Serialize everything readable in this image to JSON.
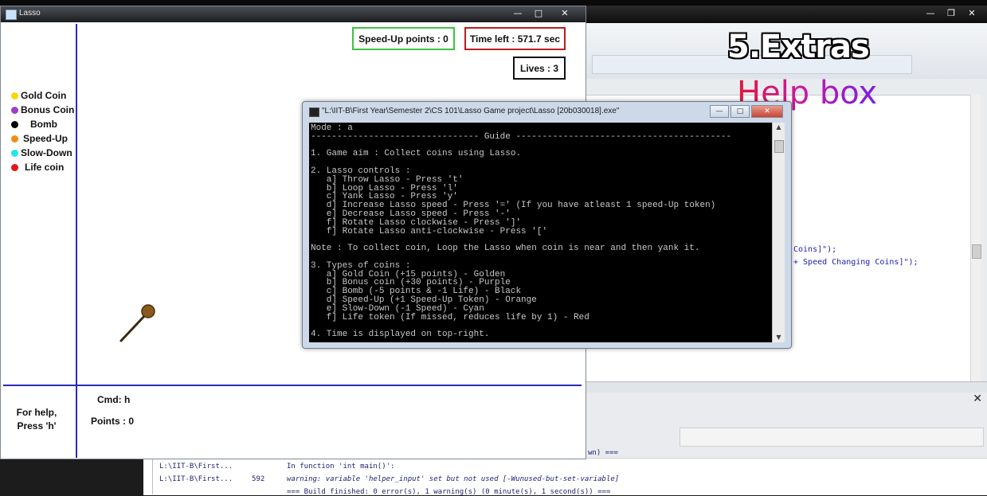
{
  "lasso_window": {
    "title": "Lasso",
    "buttons": {
      "minimize": "—",
      "maximize": "□",
      "close": "✕"
    },
    "legend": [
      {
        "label": "Gold Coin",
        "color": "#f5d90a"
      },
      {
        "label": "Bonus Coin",
        "color": "#9b3fc4"
      },
      {
        "label": "Bomb",
        "color": "#000000"
      },
      {
        "label": "Speed-Up",
        "color": "#f28c18"
      },
      {
        "label": "Slow-Down",
        "color": "#22e6ee"
      },
      {
        "label": "Life coin",
        "color": "#e3161b"
      }
    ],
    "hud": {
      "speed_up": "Speed-Up points : 0",
      "time_left": "Time left : 571.7 sec",
      "lives": "Lives : 3"
    },
    "help": {
      "line1": "For help,",
      "line2": "Press 'h'"
    },
    "cmd": "Cmd: h",
    "points": "Points : 0",
    "colors": {
      "speed_up_border": "#3fc23f",
      "time_left_border": "#b81f1f",
      "lives_border": "#111111",
      "divider": "#2a2ab8",
      "lasso": "#8a5a1a"
    }
  },
  "console": {
    "title": "\"L:\\IIT-B\\First Year\\Semester 2\\CS 101\\Lasso Game project\\Lasso [20b030018].exe\"",
    "lines": [
      "Mode : a",
      "-------------------------------- Guide -----------------------------------------",
      "",
      "1. Game aim : Collect coins using Lasso.",
      "",
      "2. Lasso controls :",
      "   a] Throw Lasso - Press 't'",
      "   b] Loop Lasso - Press 'l'",
      "   c] Yank Lasso - Press 'y'",
      "   d] Increase Lasso speed - Press '=' (If you have atleast 1 speed-Up token)",
      "   e] Decrease Lasso speed - Press '-'",
      "   f] Rotate Lasso clockwise - Press ']'",
      "   f] Rotate Lasso anti-clockwise - Press '['",
      "",
      "Note : To collect coin, Loop the Lasso when coin is near and then yank it.",
      "",
      "3. Types of coins :",
      "   a] Gold Coin (+15 points) - Golden",
      "   b] Bonus coin (+30 points) - Purple",
      "   c] Bomb (-5 points & -1 Life) - Black",
      "   d] Speed-Up (+1 Speed-Up Token) - Orange",
      "   e] Slow-Down (-1 Speed) - Cyan",
      "   f] Life token (If missed, reduces life by 1) - Red",
      "",
      "4. Time is displayed on top-right."
    ]
  },
  "overlay": {
    "title": "5.Extras",
    "subtitle": "Help box"
  },
  "ide": {
    "code_line1": "Coins]\");",
    "code_line2": "+ Speed Changing Coins]\");",
    "build_log": {
      "row1_file": "L:\\IIT-B\\First...",
      "row1_msg": "In function 'int main()':",
      "row2_file": "L:\\IIT-B\\First...",
      "row2_line": "592",
      "row2_msg": "warning: variable 'helper_input' set but not used [-Wunused-but-set-variable]",
      "row3_msg": "=== Build finished: 0 error(s), 1 warning(s) (0 minute(s), 1 second(s)) ===",
      "row0_msg": "wn) ==="
    },
    "panel_close": "✕"
  }
}
